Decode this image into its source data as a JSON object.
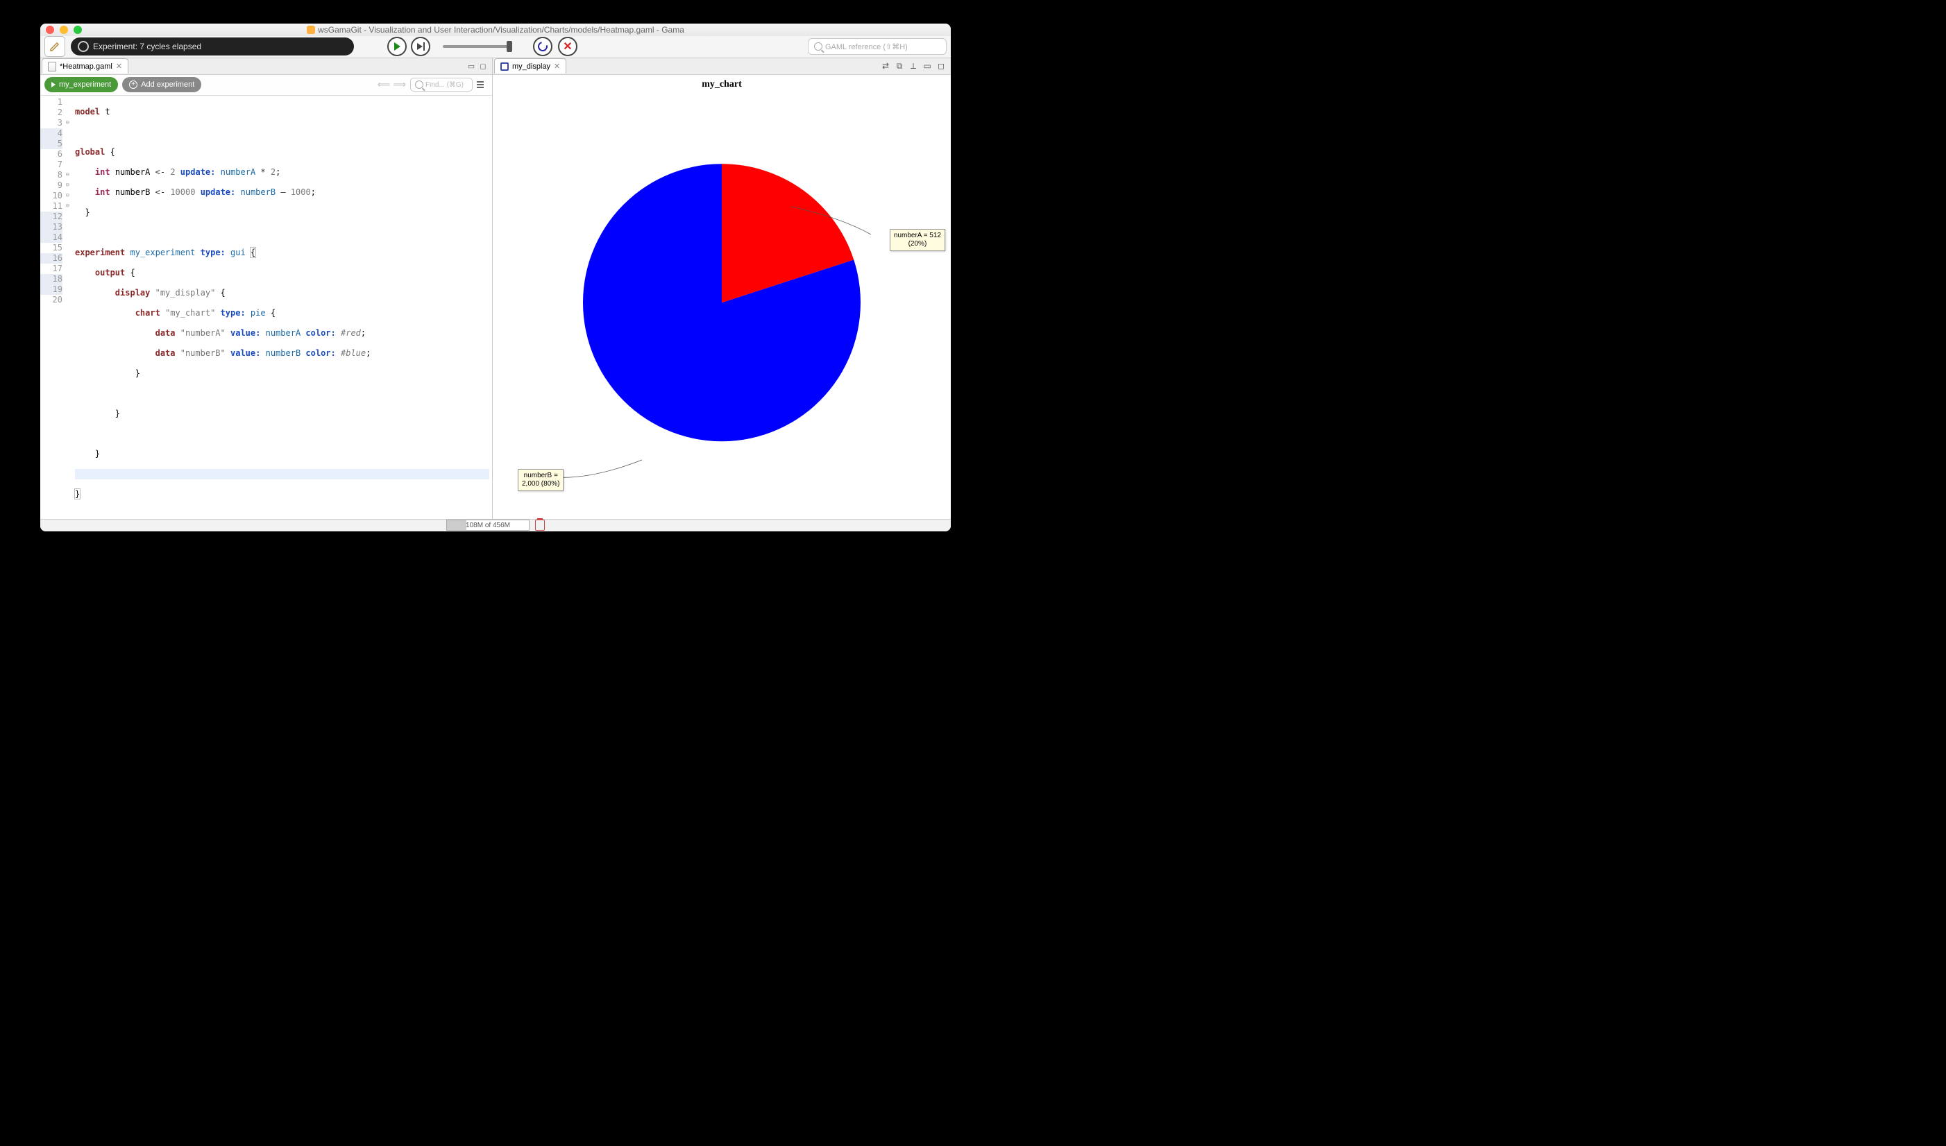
{
  "window": {
    "title": "wsGamaGit - Visualization and User Interaction/Visualization/Charts/models/Heatmap.gaml - Gama"
  },
  "toolbar": {
    "experiment_status": "Experiment: 7 cycles elapsed",
    "search_placeholder": "GAML reference (⇧⌘H)"
  },
  "editor": {
    "tab_label": "*Heatmap.gaml",
    "run_button": "my_experiment",
    "add_button": "Add experiment",
    "find_placeholder": "Find... (⌘G)",
    "lines": [
      "1",
      "2",
      "3",
      "4",
      "5",
      "6",
      "7",
      "8",
      "9",
      "10",
      "11",
      "12",
      "13",
      "14",
      "15",
      "16",
      "17",
      "18",
      "19",
      "20"
    ],
    "code": {
      "l1_model": "model",
      "l1_t": "t",
      "l3_global": "global",
      "l3_brace": "{",
      "l4_int": "int",
      "l4_na": "numberA",
      "l4_arrow": "<-",
      "l4_2": "2",
      "l4_update": "update:",
      "l4_na2": "numberA",
      "l4_times": "*",
      "l4_2b": "2",
      "l4_semi": ";",
      "l5_int": "int",
      "l5_nb": "numberB",
      "l5_arrow": "<-",
      "l5_10000": "10000",
      "l5_update": "update:",
      "l5_nb2": "numberB",
      "l5_minus": "–",
      "l5_1000": "1000",
      "l5_semi": ";",
      "l6": "}",
      "l8_exp": "experiment",
      "l8_name": "my_experiment",
      "l8_type": "type:",
      "l8_gui": "gui",
      "l8_brace": "{",
      "l9_output": "output",
      "l9_brace": "{",
      "l10_display": "display",
      "l10_name": "\"my_display\"",
      "l10_brace": "{",
      "l11_chart": "chart",
      "l11_name": "\"my_chart\"",
      "l11_type": "type:",
      "l11_pie": "pie",
      "l11_brace": "{",
      "l12_data": "data",
      "l12_s": "\"numberA\"",
      "l12_value": "value:",
      "l12_na": "numberA",
      "l12_color": "color:",
      "l12_red": "#red",
      "l12_semi": ";",
      "l13_data": "data",
      "l13_s": "\"numberB\"",
      "l13_value": "value:",
      "l13_nb": "numberB",
      "l13_color": "color:",
      "l13_blue": "#blue",
      "l13_semi": ";",
      "l14": "}",
      "l16": "}",
      "l18": "}",
      "l20": "}"
    }
  },
  "display": {
    "tab_label": "my_display",
    "chart_title": "my_chart",
    "labelA_line1": "numberA = 512",
    "labelA_line2": "(20%)",
    "labelB_line1": "numberB =",
    "labelB_line2": "2,000 (80%)"
  },
  "status": {
    "memory": "108M of 456M"
  },
  "chart_data": {
    "type": "pie",
    "title": "my_chart",
    "series": [
      {
        "name": "numberA",
        "value": 512,
        "percent": 20,
        "color": "#ff0000"
      },
      {
        "name": "numberB",
        "value": 2000,
        "percent": 80,
        "color": "#0000ff"
      }
    ]
  }
}
